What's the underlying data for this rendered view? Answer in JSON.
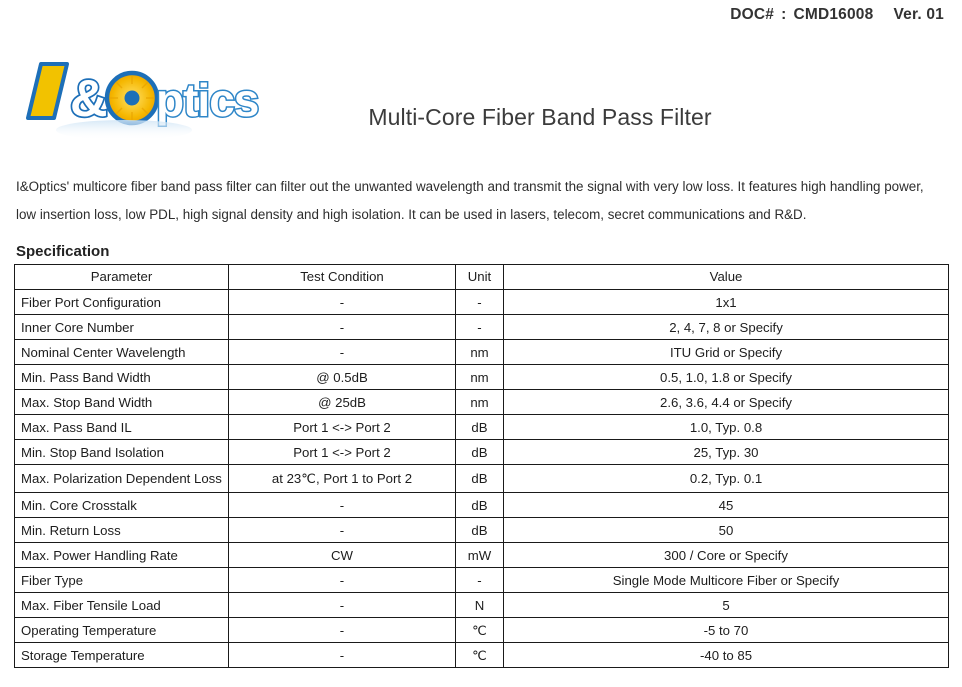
{
  "doc_header": {
    "doc_label": "DOC#",
    "separator": ":",
    "doc_number": "CMD16008",
    "version": "Ver. 01"
  },
  "brand": {
    "logo_text": "I&Optics",
    "logo_letter_i": "I",
    "logo_ampersand": "&",
    "logo_word": "ptics",
    "colors": {
      "gold": "#F2C200",
      "blue": "#1D6FB8",
      "blue_dark": "#13508C",
      "orange": "#F5A623"
    }
  },
  "product": {
    "title": "Multi-Core Fiber Band Pass Filter"
  },
  "intro": {
    "text": "I&Optics' multicore fiber band pass filter can filter out the unwanted wavelength and transmit the signal with very low loss. It features high handling power, low insertion loss, low PDL, high signal density and high isolation. It can be used in lasers, telecom, secret communications and R&D."
  },
  "specification": {
    "heading": "Specification",
    "columns": [
      "Parameter",
      "Test Condition",
      "Unit",
      "Value"
    ],
    "rows": [
      {
        "parameter": "Fiber Port Configuration",
        "condition": "-",
        "unit": "-",
        "value": "1x1"
      },
      {
        "parameter": "Inner Core Number",
        "condition": "-",
        "unit": "-",
        "value": "2, 4, 7, 8 or Specify"
      },
      {
        "parameter": "Nominal Center Wavelength",
        "condition": "-",
        "unit": "nm",
        "value": "ITU Grid or Specify"
      },
      {
        "parameter": "Min. Pass Band Width",
        "condition": "@ 0.5dB",
        "unit": "nm",
        "value": "0.5, 1.0, 1.8 or Specify"
      },
      {
        "parameter": "Max. Stop Band Width",
        "condition": "@ 25dB",
        "unit": "nm",
        "value": "2.6, 3.6, 4.4 or Specify"
      },
      {
        "parameter": "Max. Pass Band IL",
        "condition": "Port 1 <-> Port 2",
        "unit": "dB",
        "value": "1.0, Typ. 0.8"
      },
      {
        "parameter": "Min. Stop Band Isolation",
        "condition": "Port 1 <-> Port 2",
        "unit": "dB",
        "value": "25, Typ. 30"
      },
      {
        "parameter": "Max. Polarization Dependent Loss",
        "condition": "at 23℃, Port 1 to Port 2",
        "unit": "dB",
        "value": "0.2, Typ. 0.1",
        "tall": true
      },
      {
        "parameter": "Min. Core Crosstalk",
        "condition": "-",
        "unit": "dB",
        "value": "45"
      },
      {
        "parameter": "Min. Return Loss",
        "condition": "-",
        "unit": "dB",
        "value": "50"
      },
      {
        "parameter": "Max. Power Handling Rate",
        "condition": "CW",
        "unit": "mW",
        "value": "300 / Core or Specify"
      },
      {
        "parameter": "Fiber Type",
        "condition": "-",
        "unit": "-",
        "value": "Single Mode Multicore Fiber or Specify"
      },
      {
        "parameter": "Max. Fiber Tensile Load",
        "condition": "-",
        "unit": "N",
        "value": "5"
      },
      {
        "parameter": "Operating Temperature",
        "condition": "-",
        "unit": "℃",
        "value": "-5 to 70"
      },
      {
        "parameter": "Storage Temperature",
        "condition": "-",
        "unit": "℃",
        "value": "-40 to 85"
      }
    ]
  }
}
